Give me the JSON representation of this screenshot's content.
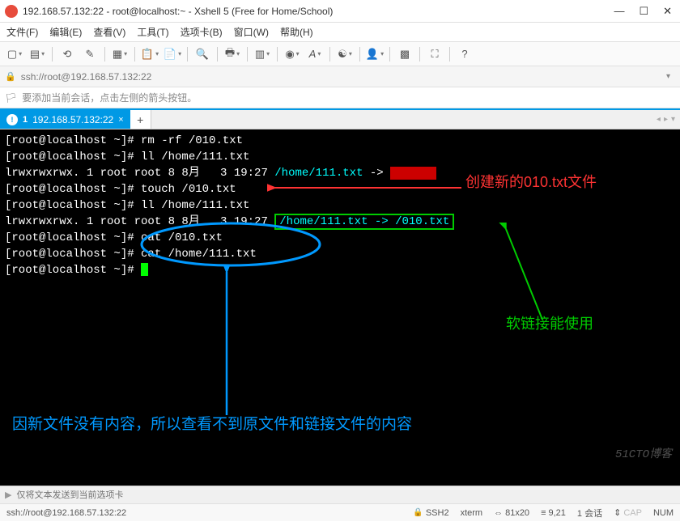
{
  "window": {
    "title": "192.168.57.132:22 - root@localhost:~ - Xshell 5 (Free for Home/School)"
  },
  "menu": {
    "file": "文件(F)",
    "edit": "编辑(E)",
    "view": "查看(V)",
    "tools": "工具(T)",
    "tabs": "选项卡(B)",
    "window": "窗口(W)",
    "help": "帮助(H)"
  },
  "address": {
    "url": "ssh://root@192.168.57.132:22"
  },
  "hint": {
    "text": "要添加当前会话，点击左侧的箭头按钮。"
  },
  "tab": {
    "num": "1",
    "label": "192.168.57.132:22"
  },
  "terminal": {
    "l1": "[root@localhost ~]# rm -rf /010.txt",
    "l2": "[root@localhost ~]# ll /home/111.txt",
    "l3a": "lrwxrwxrwx. 1 root root 8 8月   3 19:27 ",
    "l3b": "/home/111.txt",
    "l3c": " -> ",
    "l4": "[root@localhost ~]# touch /010.txt",
    "l5": "[root@localhost ~]# ll /home/111.txt",
    "l6a": "lrwxrwxrwx. 1 root root 8 8月   3 19:27 ",
    "l6b": "/home/111.txt -> /010.txt",
    "l7": "[root@localhost ~]# cat /010.txt",
    "l8": "[root@localhost ~]# cat /home/111.txt",
    "l9": "[root@localhost ~]# "
  },
  "annotations": {
    "red": "创建新的010.txt文件",
    "green": "软链接能使用",
    "blue": "因新文件没有内容，所以查看不到原文件和链接文件的内容"
  },
  "watermark": "51CTO博客",
  "sendbar": {
    "placeholder": "仅将文本发送到当前选项卡"
  },
  "status": {
    "left": "ssh://root@192.168.57.132:22",
    "ssh": "SSH2",
    "term": "xterm",
    "size": "81x20",
    "pos": "9,21",
    "sessions": "1 会话",
    "caps": "CAP",
    "num": "NUM"
  }
}
